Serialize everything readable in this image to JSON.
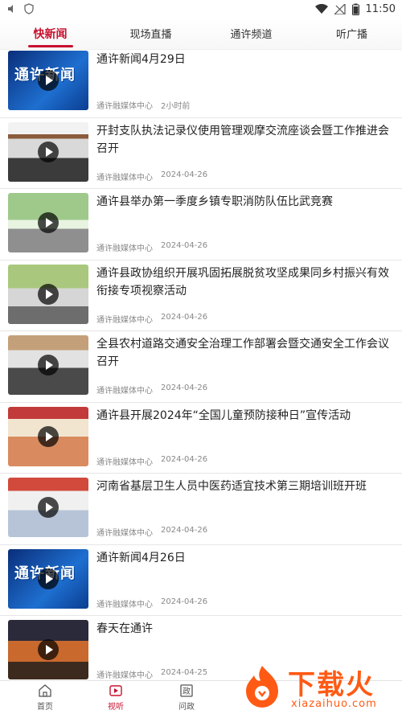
{
  "status_bar": {
    "time": "11:50",
    "icons": [
      "mute-icon",
      "shield-icon",
      "wifi-icon",
      "signal-icon",
      "battery-icon"
    ]
  },
  "tabs": [
    {
      "label": "快新闻",
      "active": true
    },
    {
      "label": "现场直播",
      "active": false
    },
    {
      "label": "通许频道",
      "active": false
    },
    {
      "label": "听广播",
      "active": false
    }
  ],
  "news": [
    {
      "title": "通许新闻4月29日",
      "source": "通许融媒体中心",
      "time": "2小时前",
      "thumb": "news-logo"
    },
    {
      "title": "开封支队执法记录仪使用管理观摩交流座谈会暨工作推进会召开",
      "source": "通许融媒体中心",
      "time": "2024-04-26",
      "thumb": "meeting"
    },
    {
      "title": "通许县举办第一季度乡镇专职消防队伍比武竞赛",
      "source": "通许融媒体中心",
      "time": "2024-04-26",
      "thumb": "fire-drill"
    },
    {
      "title": "通许县政协组织开展巩固拓展脱贫攻坚成果同乡村振兴有效衔接专项视察活动",
      "source": "通许融媒体中心",
      "time": "2024-04-26",
      "thumb": "village-visit"
    },
    {
      "title": "全县农村道路交通安全治理工作部署会暨交通安全工作会议召开",
      "source": "通许融媒体中心",
      "time": "2024-04-26",
      "thumb": "conference-hall"
    },
    {
      "title": "通许县开展2024年“全国儿童预防接种日”宣传活动",
      "source": "通许融媒体中心",
      "time": "2024-04-26",
      "thumb": "vaccination"
    },
    {
      "title": "河南省基层卫生人员中医药适宜技术第三期培训班开班",
      "source": "通许融媒体中心",
      "time": "2024-04-26",
      "thumb": "training"
    },
    {
      "title": "通许新闻4月26日",
      "source": "通许融媒体中心",
      "time": "2024-04-26",
      "thumb": "news-logo"
    },
    {
      "title": "春天在通许",
      "source": "通许融媒体中心",
      "time": "2024-04-25",
      "thumb": "spring-sunset"
    }
  ],
  "thumb_logo_text": "通许新闻",
  "bottom_nav": [
    {
      "label": "首页",
      "icon": "home-icon",
      "active": false
    },
    {
      "label": "视听",
      "icon": "play-icon",
      "active": true
    },
    {
      "label": "问政",
      "icon": "politics-icon",
      "active": false
    }
  ],
  "watermark": {
    "text": "下载火",
    "domain": "xiazaihuo.com"
  },
  "colors": {
    "accent": "#c8102e",
    "watermark": "#ff5a14"
  }
}
